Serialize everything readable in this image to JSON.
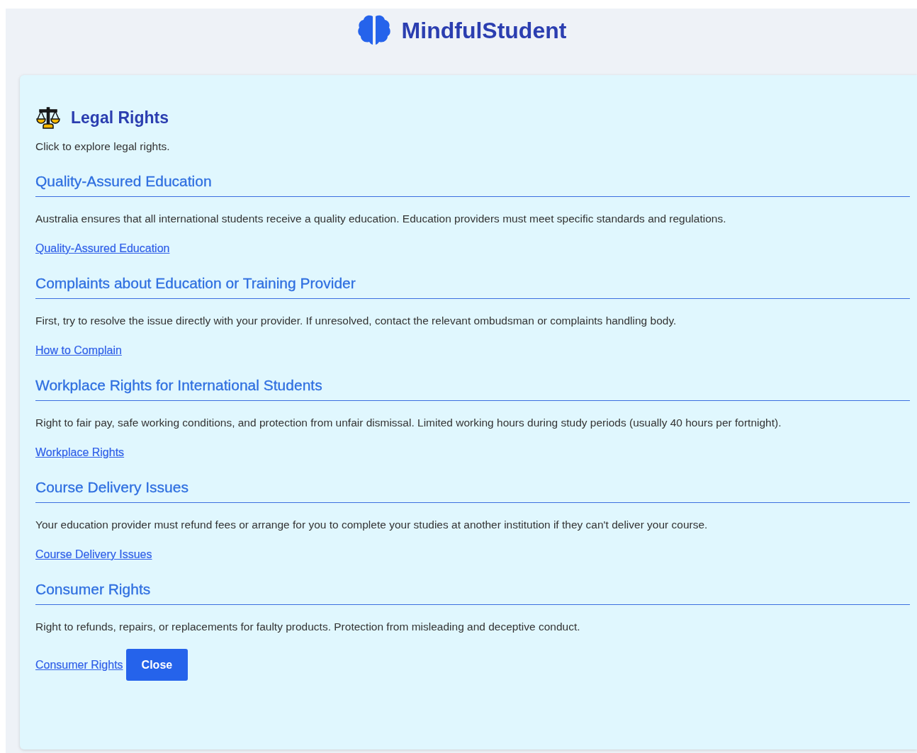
{
  "brand": {
    "name": "MindfulStudent"
  },
  "panel": {
    "title": "Legal Rights",
    "intro": "Click to explore legal rights.",
    "sections": [
      {
        "heading": "Quality-Assured Education",
        "text": "Australia ensures that all international students receive a quality education. Education providers must meet specific standards and regulations.",
        "link": "Quality-Assured Education"
      },
      {
        "heading": "Complaints about Education or Training Provider",
        "text": "First, try to resolve the issue directly with your provider. If unresolved, contact the relevant ombudsman or complaints handling body.",
        "link": "How to Complain"
      },
      {
        "heading": "Workplace Rights for International Students",
        "text": "Right to fair pay, safe working conditions, and protection from unfair dismissal. Limited working hours during study periods (usually 40 hours per fortnight).",
        "link": "Workplace Rights"
      },
      {
        "heading": "Course Delivery Issues",
        "text": "Your education provider must refund fees or arrange for you to complete your studies at another institution if they can't deliver your course.",
        "link": "Course Delivery Issues"
      },
      {
        "heading": "Consumer Rights",
        "text": "Right to refunds, repairs, or replacements for faulty products. Protection from misleading and deceptive conduct.",
        "link": "Consumer Rights"
      }
    ],
    "close_button": "Close"
  }
}
